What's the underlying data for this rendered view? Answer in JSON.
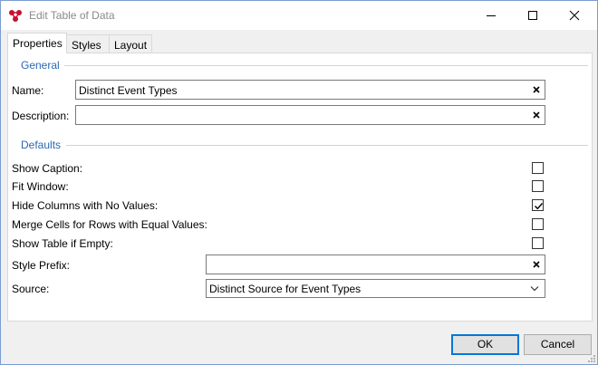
{
  "window": {
    "title": "Edit Table of Data",
    "icon": "app-logo-icon",
    "controls": [
      "minimize-icon",
      "maximize-icon",
      "close-icon"
    ]
  },
  "tabs": [
    {
      "label": "Properties",
      "active": true
    },
    {
      "label": "Styles",
      "active": false
    },
    {
      "label": "Layout",
      "active": false
    }
  ],
  "general": {
    "header": "General",
    "name_label": "Name:",
    "name_value": "Distinct Event Types",
    "description_label": "Description:",
    "description_value": ""
  },
  "defaults": {
    "header": "Defaults",
    "checkboxes": [
      {
        "label": "Show Caption:",
        "checked": false
      },
      {
        "label": "Fit Window:",
        "checked": false
      },
      {
        "label": "Hide Columns with No Values:",
        "checked": true
      },
      {
        "label": "Merge Cells for Rows with Equal Values:",
        "checked": false
      },
      {
        "label": "Show Table if Empty:",
        "checked": false
      }
    ],
    "style_prefix_label": "Style Prefix:",
    "style_prefix_value": "",
    "source_label": "Source:",
    "source_value": "Distinct Source for Event Types"
  },
  "buttons": {
    "ok": "OK",
    "cancel": "Cancel"
  },
  "colors": {
    "group_header": "#2a68b6",
    "default_button_border": "#0078d7",
    "logo_red": "#c8102e"
  }
}
